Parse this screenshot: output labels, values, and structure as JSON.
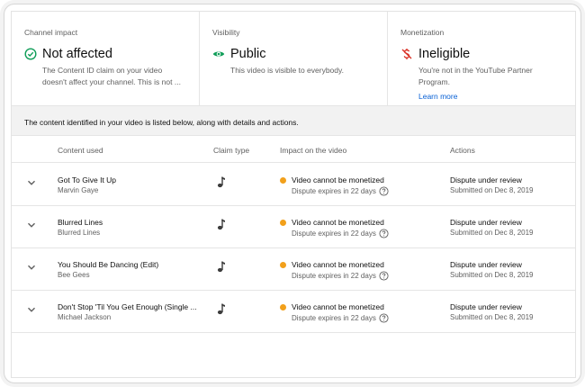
{
  "summary": {
    "channel_impact": {
      "label": "Channel impact",
      "value": "Not affected",
      "icon": "check-circle-icon",
      "description_line1": "The Content ID claim on your video",
      "description_line2": "doesn't affect your channel. This is not ..."
    },
    "visibility": {
      "label": "Visibility",
      "value": "Public",
      "icon": "eye-icon",
      "description_line1": "This video is visible to everybody."
    },
    "monetization": {
      "label": "Monetization",
      "value": "Ineligible",
      "icon": "no-dollar-icon",
      "description_line1": "You're not in the YouTube Partner",
      "description_line2": "Program.",
      "link": "Learn more"
    }
  },
  "banner": "The content identified in your video is listed below, along with details and actions.",
  "table": {
    "headers": {
      "content": "Content used",
      "claim": "Claim type",
      "impact": "Impact on the video",
      "actions": "Actions"
    },
    "rows": [
      {
        "title": "Got To Give It Up",
        "artist": "Marvin Gaye",
        "claim_icon": "music-note-icon",
        "impact": "Video cannot be monetized",
        "dispute": "Dispute expires in 22 days",
        "action": "Dispute under review",
        "submitted": "Submitted on Dec 8, 2019"
      },
      {
        "title": "Blurred Lines",
        "artist": "Blurred Lines",
        "claim_icon": "music-note-icon",
        "impact": "Video cannot be monetized",
        "dispute": "Dispute expires in 22 days",
        "action": "Dispute under review",
        "submitted": "Submitted on Dec 8, 2019"
      },
      {
        "title": "You Should Be Dancing (Edit)",
        "artist": "Bee Gees",
        "claim_icon": "music-note-icon",
        "impact": "Video cannot be monetized",
        "dispute": "Dispute expires in 22 days",
        "action": "Dispute under review",
        "submitted": "Submitted on Dec 8, 2019"
      },
      {
        "title": "Don't Stop 'Til You Get Enough (Single ...",
        "artist": "Michael Jackson",
        "claim_icon": "music-note-icon",
        "impact": "Video cannot be monetized",
        "dispute": "Dispute expires in 22 days",
        "action": "Dispute under review",
        "submitted": "Submitted on Dec 8, 2019"
      }
    ]
  },
  "colors": {
    "check": "#0f9d58",
    "eye": "#0f9d58",
    "no_dollar": "#d93025",
    "link": "#065fd4",
    "impact_dot": "#f2a01b"
  }
}
